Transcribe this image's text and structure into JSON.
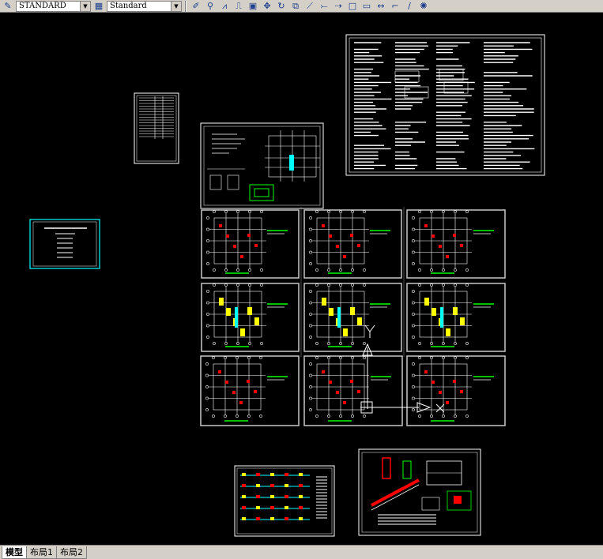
{
  "toolbar": {
    "text_style_value": "STANDARD",
    "dim_style_value": "Standard",
    "icons": [
      "text-style-icon",
      "dim-style-icon",
      "pencil-icon",
      "match-properties-icon",
      "mirror-icon",
      "offset-icon",
      "array-icon",
      "move-icon",
      "rotate-icon",
      "scale-icon",
      "stretch-icon",
      "trim-icon",
      "extend-icon",
      "break-icon",
      "join-icon",
      "chamfer-icon",
      "fillet-icon",
      "explode-icon"
    ]
  },
  "layout_tabs": [
    {
      "label": "模型",
      "active": true
    },
    {
      "label": "布局1",
      "active": false
    },
    {
      "label": "布局2",
      "active": false
    }
  ],
  "colors": {
    "canvas": "#000000",
    "frame": "#ffffff",
    "accent_cyan": "#00ffff",
    "accent_red": "#ff0000",
    "accent_yellow": "#ffff00",
    "accent_green": "#00ff00"
  }
}
